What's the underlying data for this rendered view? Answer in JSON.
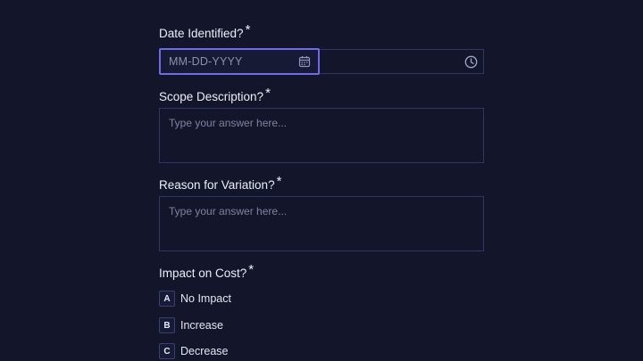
{
  "form": {
    "required_marker": "*",
    "date_question": {
      "label": "Date Identified?",
      "date_placeholder": "MM-DD-YYYY",
      "calendar_icon": "calendar-icon",
      "clock_icon": "clock-icon"
    },
    "scope_question": {
      "label": "Scope Description?",
      "placeholder": "Type your answer here..."
    },
    "reason_question": {
      "label": "Reason for Variation?",
      "placeholder": "Type your answer here..."
    },
    "impact_question": {
      "label": "Impact on Cost?",
      "options": [
        {
          "key": "A",
          "label": "No Impact"
        },
        {
          "key": "B",
          "label": "Increase"
        },
        {
          "key": "C",
          "label": "Decrease"
        }
      ]
    }
  },
  "colors": {
    "background": "#13162b",
    "accent_border": "#6d6be8",
    "field_border": "#2f3566"
  }
}
